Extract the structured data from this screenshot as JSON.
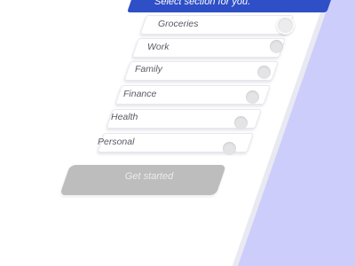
{
  "header": {
    "prompt": "Select section for you."
  },
  "sections": [
    {
      "label": "Groceries",
      "selected": false
    },
    {
      "label": "Work",
      "selected": false
    },
    {
      "label": "Family",
      "selected": false
    },
    {
      "label": "Finance",
      "selected": false
    },
    {
      "label": "Health",
      "selected": false
    },
    {
      "label": "Personal",
      "selected": false
    }
  ],
  "actions": {
    "get_started_label": "Get started"
  },
  "colors": {
    "background": "#cccdfb",
    "header": "#2e4fc6",
    "button_disabled": "#bdbdbd",
    "radio": "#e4e4e6"
  }
}
